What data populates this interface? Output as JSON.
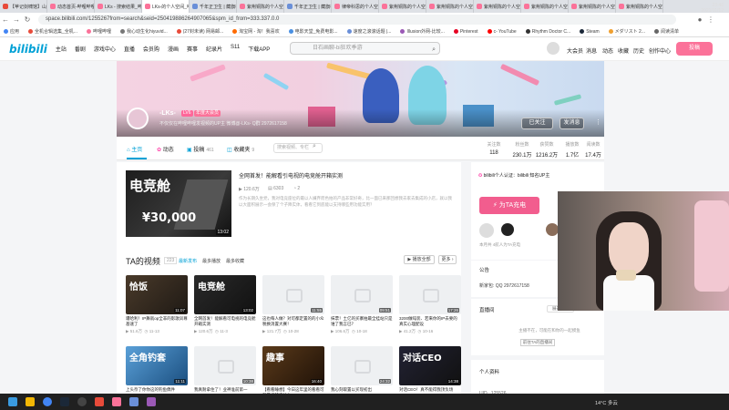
{
  "browser": {
    "tabs": [
      {
        "title": "【苹记剑啸馆】山↑",
        "color": "#e84b3a"
      },
      {
        "title": "动态首页-哔哩哔哩",
        "color": "#fb7299"
      },
      {
        "title": "LKs - 搜索结果_哔哩",
        "color": "#fb7299"
      },
      {
        "title": "LKs-的个人空间_哔哩",
        "color": "#fb7299",
        "active": true
      },
      {
        "title": "千年正卫生 | 藏旗棋",
        "color": "#6a8fd8"
      },
      {
        "title": "紫荆铜陈的个人空间",
        "color": "#fb7299"
      },
      {
        "title": "千年正卫生 | 藏旗棋",
        "color": "#6a8fd8"
      },
      {
        "title": "律帝科思的个人空间",
        "color": "#fb7299"
      },
      {
        "title": "紫荆铜陈的个人空间",
        "color": "#fb7299"
      },
      {
        "title": "紫荆铜陈的个人空间",
        "color": "#fb7299"
      },
      {
        "title": "紫荆铜陈的个人空间",
        "color": "#fb7299"
      },
      {
        "title": "紫荆铜陈的个人空间",
        "color": "#fb7299"
      },
      {
        "title": "紫荆铜陈的个人空间",
        "color": "#fb7299"
      },
      {
        "title": "紫荆铜陈的个人空间",
        "color": "#fb7299"
      }
    ],
    "url": "space.bilibili.com/1255267from=search&seid=250419886264907065&spm_id_from=333.337.0.0",
    "bookmarks": [
      {
        "label": "应用",
        "color": "#4285f4"
      },
      {
        "label": "全机合辑选集_全机...",
        "color": "#e84b3a"
      },
      {
        "label": "哔哩哔哩",
        "color": "#fb7299"
      },
      {
        "label": "我心动生化hiyuvid...",
        "color": "#777777"
      },
      {
        "label": "(27封未读) 网易邮...",
        "color": "#e84b3a"
      },
      {
        "label": "淘宝网 - 淘！我喜欢",
        "color": "#ff6a00"
      },
      {
        "label": "电影天堂_免费电影...",
        "color": "#4a90e2"
      },
      {
        "label": "速度之滚滚话题 |...",
        "color": "#6a8fd8"
      },
      {
        "label": "Illusion外网-比较...",
        "color": "#9b59b6"
      },
      {
        "label": "Pinterest",
        "color": "#e60023"
      },
      {
        "label": "c- YouTube",
        "color": "#ff0000"
      },
      {
        "label": "Rhythm Doctor C...",
        "color": "#333333"
      },
      {
        "label": "Steam",
        "color": "#1b2838"
      },
      {
        "label": "メダリスト 2...",
        "color": "#f0a030"
      },
      {
        "label": "阅读清单",
        "color": "#666666"
      }
    ]
  },
  "header": {
    "logo": "bilibili",
    "nav": [
      "主站",
      "番剧",
      "游戏中心",
      "直播",
      "会员购",
      "漫画",
      "赛事",
      "纪录片",
      "S11",
      "下载APP"
    ],
    "search_placeholder": "日石画聊-bi狂欢季游",
    "right_nav": [
      "大会员",
      "消息",
      "动态",
      "收藏",
      "历史",
      "创作中心"
    ],
    "post_label": "投稿"
  },
  "profile": {
    "name": "-LKs-",
    "level": "LV6",
    "vip": "年度大会员",
    "signature": "不仅仅在哔哩哔哩发视频的UP主 微博@-LKs-  Q群 2972617158",
    "follow_label": "已关注",
    "message_label": "发消息",
    "more": "⋮"
  },
  "subnav": {
    "tabs": [
      {
        "label": "主页",
        "count": ""
      },
      {
        "label": "动态",
        "count": ""
      },
      {
        "label": "投稿",
        "count": "461"
      },
      {
        "label": "收藏夹",
        "count": "9"
      }
    ],
    "search_placeholder": "搜索视频、专栏",
    "stats": [
      {
        "label": "关注数",
        "value": "118"
      },
      {
        "label": "粉丝数",
        "value": "230.1万"
      },
      {
        "label": "获赞数",
        "value": "1216.2万"
      },
      {
        "label": "播放数",
        "value": "1.7亿"
      },
      {
        "label": "阅读数",
        "value": "17.4万"
      }
    ]
  },
  "featured": {
    "title": "全网首发！能解看引电视的电竞舱开箱实测",
    "thumb_text": "电竞舱",
    "thumb_price": "¥30,000",
    "duration": "13:02",
    "plays": "120.6万",
    "danmaku": "6303",
    "extra": "2",
    "desc": "作为长期久坐党，我对电竞座位的最以人嫌弃而色拍的产品非常好奇，比一面已来那回想我去家去集成的小店，就以我以大面积展示一会保了个子降实体，看看它到底能以支持哪些用功能实用？"
  },
  "videos": {
    "title": "TA的视频",
    "count": "223",
    "sorts": [
      "最新发布",
      "最多播放",
      "最多收藏"
    ],
    "play_all": "播放全部",
    "more": "更多",
    "items": [
      {
        "title": "遭哈利！IP舞就op全非的影歌凤尊基速了",
        "plays": "51.6万",
        "time": "11-13",
        "duration": "11:07",
        "thumb": "dark",
        "text": "恰饭"
      },
      {
        "title": "全网首发！能解看可电视的电竞舱开箱实测",
        "plays": "120.6万",
        "time": "11-3",
        "duration": "13:02",
        "thumb": "dark2",
        "text": "电竞舱"
      },
      {
        "title": "这也每人做？对可都定置的的小众税换消置大赛！",
        "plays": "121.7万",
        "time": "10-28",
        "duration": "11:55",
        "thumb": "ph",
        "text": ""
      },
      {
        "title": "抹票！土亿的买寨拍最全挂站只是谁了我言已？",
        "plays": "106.6万",
        "time": "10-18",
        "duration": "09:51",
        "thumb": "ph",
        "text": ""
      },
      {
        "title": "3200做吨装、若来你的IP去要的真实心理配设",
        "plays": "41.2万",
        "time": "10-16",
        "duration": "17:26",
        "thumb": "ph",
        "text": ""
      },
      {
        "title": "上头奈了你你这的钓鱼偶件",
        "plays": "",
        "time": "",
        "duration": "11:11",
        "thumb": "blue",
        "text": "全角钓套"
      },
      {
        "title": "我真耐拿住了！业神准前第一",
        "plays": "",
        "time": "",
        "duration": "10:38",
        "thumb": "ph",
        "text": ""
      },
      {
        "title": "【看看睡想】今日这年里的看看可到最想的事什么",
        "plays": "",
        "time": "",
        "duration": "16:40",
        "thumb": "dark3",
        "text": "趣事"
      },
      {
        "title": "我心刻取置以买现初出",
        "plays": "",
        "time": "",
        "duration": "24:32",
        "thumb": "ph",
        "text": ""
      },
      {
        "title": "对话CEO！真不能得我顶负场",
        "plays": "",
        "time": "",
        "duration": "14:38",
        "thumb": "dark4",
        "text": "对话CEO"
      }
    ]
  },
  "sidebar": {
    "cert": "bilibili个人认证：bilibili 知名UP主",
    "charge_label": "为TA充电",
    "charge_note": "本月共 4航人为TA充电",
    "notice_title": "公告",
    "notice_text": "新家包: QQ 2972617158",
    "live_title": "直播间",
    "live_toggle": "展开更多",
    "live_text": "主播不在，可能在和你的一起摸鱼",
    "live_btn": "前往TA的直播间",
    "profile_title": "个人资料",
    "uid_label": "UID",
    "uid": "125526"
  },
  "taskbar": {
    "weather": "14°C 多云",
    "time": "23:46",
    "date": "2021/11/12"
  }
}
